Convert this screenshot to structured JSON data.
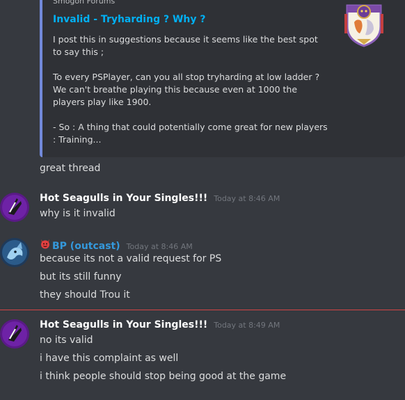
{
  "embed": {
    "provider": "Smogon Forums",
    "title": "Invalid - Tryharding ? Why ?",
    "paragraphs": [
      "I post this in suggestions because it seems like the best spot to say this ;",
      "To every PSPlayer, can you all stop tryharding at low ladder ? We can't breathe playing this because even at 1000 the players play like 1900.",
      "- So : A thing that could potentially come great for new players : Training..."
    ],
    "accent": "#7289da",
    "title_color": "#00b0f4"
  },
  "continuation": "great thread",
  "messages": [
    {
      "username": "Hot Seagulls in Your Singles!!!",
      "timestamp": "Today at 8:46 AM",
      "lines": [
        "why is it invalid"
      ]
    },
    {
      "username": "BP (outcast)",
      "timestamp": "Today at 8:46 AM",
      "lines": [
        "because its not a valid request for PS",
        "but its still funny",
        "they should Trou it"
      ],
      "name_color": "#3498db"
    },
    {
      "username": "Hot Seagulls in Your Singles!!!",
      "timestamp": "Today at 8:49 AM",
      "lines": [
        "no its valid",
        "i have this complaint as well",
        "i think people should stop being good at the game"
      ]
    }
  ],
  "colors": {
    "background": "#36393f",
    "new_divider": "#f04747"
  }
}
